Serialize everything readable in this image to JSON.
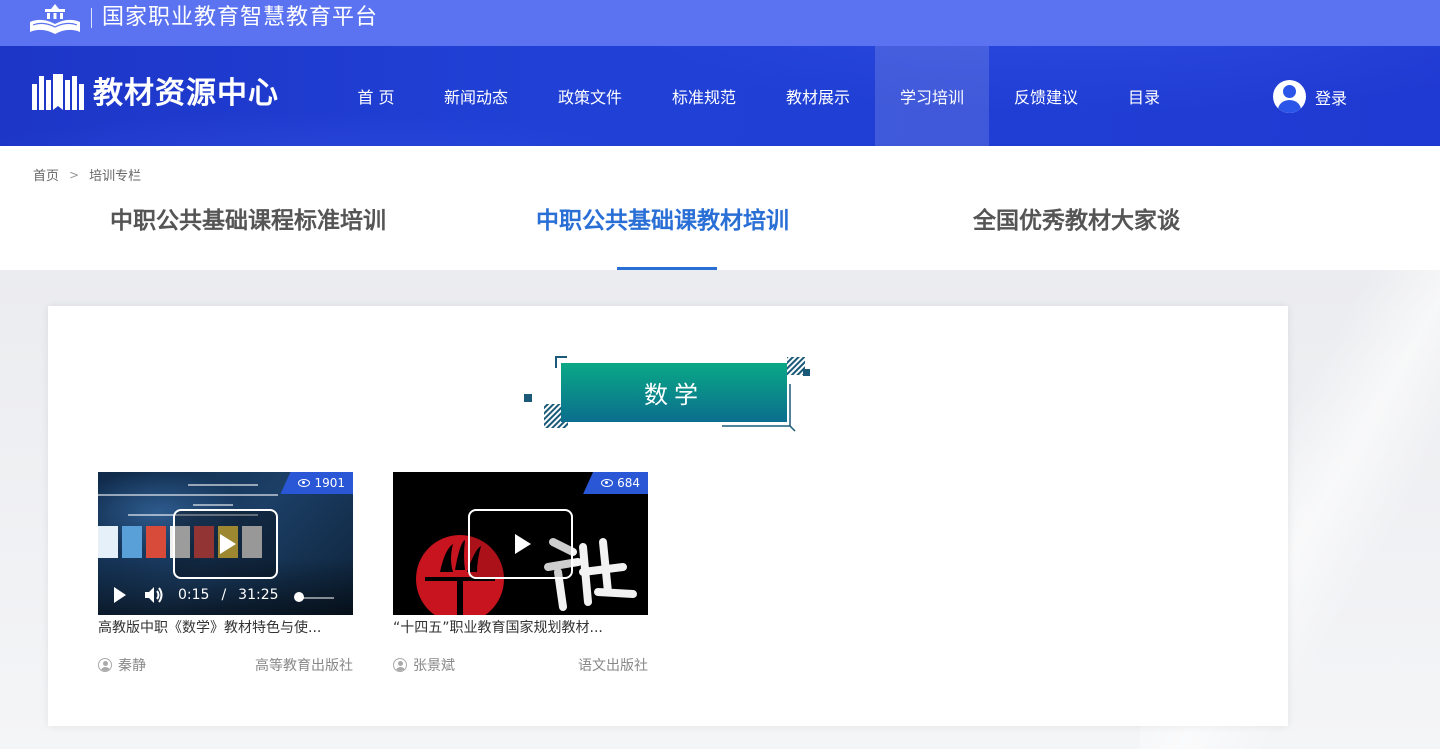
{
  "platform": {
    "title": "国家职业教育智慧教育平台"
  },
  "site": {
    "title": "教材资源中心"
  },
  "nav": {
    "items": [
      {
        "label": "首 页"
      },
      {
        "label": "新闻动态"
      },
      {
        "label": "政策文件"
      },
      {
        "label": "标准规范"
      },
      {
        "label": "教材展示"
      },
      {
        "label": "学习培训"
      },
      {
        "label": "反馈建议"
      },
      {
        "label": "目录"
      }
    ],
    "active_index": 5,
    "login_label": "登录"
  },
  "breadcrumb": {
    "home": "首页",
    "current": "培训专栏"
  },
  "tabs": [
    {
      "label": "中职公共基础课程标准培训"
    },
    {
      "label": "中职公共基础课教材培训"
    },
    {
      "label": "全国优秀教材大家谈"
    }
  ],
  "active_tab": 1,
  "subject": {
    "title": "数学"
  },
  "videos": [
    {
      "views": "1901",
      "title": "高教版中职《数学》教材特色与使...",
      "author": "秦静",
      "publisher": "高等教育出版社",
      "current_time": "0:15",
      "duration": "31:25",
      "progress": 0.01
    },
    {
      "views": "684",
      "title": "“十四五”职业教育国家规划教材...",
      "author": "张景斌",
      "publisher": "语文出版社"
    }
  ],
  "colors": {
    "platform_bar": "#5b73f0",
    "nav_bg": "#1f3ad2",
    "active_tab": "#2a6fd6",
    "badge_top": "#0aa886",
    "badge_bottom": "#0b6e8e",
    "views_badge": "#2a57d6"
  }
}
